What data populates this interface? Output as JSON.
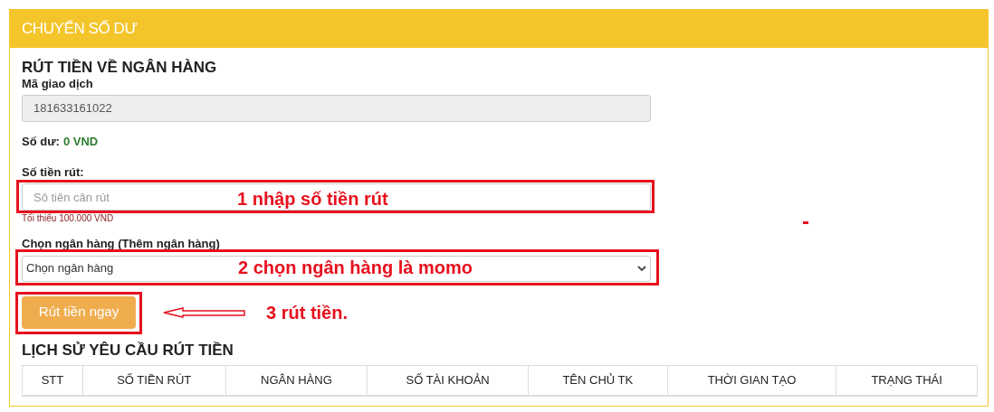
{
  "panel": {
    "title": "CHUYỂN SỐ DƯ"
  },
  "form": {
    "title": "RÚT TIỀN VỀ NGÂN HÀNG",
    "transaction_label": "Mã giao dịch",
    "transaction_value": "181633161022",
    "balance_label": "Số dư:",
    "balance_value": "0 VND",
    "amount_label": "Số tiền rút:",
    "amount_placeholder": "Sô tiên cân rút",
    "amount_hint": "Tối thiểu 100.000 VND",
    "bank_label": "Chọn ngân hàng (Thêm ngân hàng)",
    "bank_value": "Chọn ngân hàng",
    "submit": "Rút tiền ngay"
  },
  "annotations": {
    "amount_note": "1 nhập số tiền rút",
    "bank_note": "2 chọn ngân hàng là momo",
    "submit_note": "3 rút tiền."
  },
  "history": {
    "title": "LỊCH SỬ YÊU CẦU RÚT TIỀN",
    "columns": [
      "STT",
      "SỐ TIỀN RÚT",
      "NGÂN HÀNG",
      "SỐ TÀI KHOẢN",
      "TÊN CHỦ TK",
      "THỜI GIAN TẠO",
      "TRẠNG THÁI"
    ]
  }
}
